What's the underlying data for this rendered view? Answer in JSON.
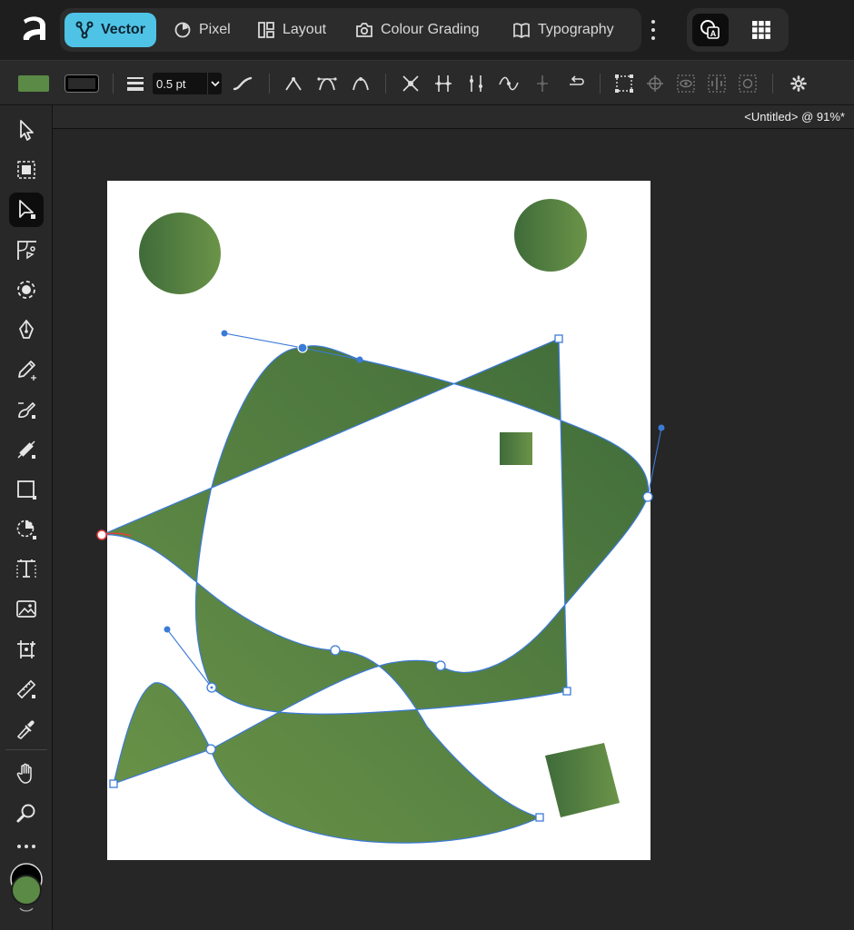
{
  "personas": [
    {
      "label": "Vector",
      "icon": "vector-persona-icon",
      "active": true
    },
    {
      "label": "Pixel",
      "icon": "pixel-persona-icon",
      "active": false
    },
    {
      "label": "Layout",
      "icon": "layout-persona-icon",
      "active": false
    },
    {
      "label": "Colour Grading",
      "icon": "camera-icon",
      "active": false
    },
    {
      "label": "Typography",
      "icon": "book-icon",
      "active": false
    }
  ],
  "context_toolbar": {
    "stroke_width": "0.5 pt"
  },
  "document": {
    "title": "<Untitled> @ 91%*"
  },
  "colors": {
    "accent": "#4fc3e6",
    "fill": "#5a8a45",
    "shape_dark": "#3f6b3a",
    "shape_light": "#6b9448",
    "path_selection": "#3b7bd8",
    "start_node": "#e0413b"
  },
  "tools": [
    "move-tool-icon",
    "artboard-select-tool-icon",
    "node-tool-icon",
    "corner-tool-icon",
    "shape-builder-tool-icon",
    "pen-tool-icon",
    "pencil-tool-icon",
    "vector-brush-tool-icon",
    "fill-tool-icon",
    "rectangle-tool-icon",
    "pie-tool-icon",
    "frame-text-tool-icon",
    "image-tool-icon",
    "place-tool-icon",
    "measure-tool-icon",
    "colour-picker-tool-icon",
    "hand-tool-icon",
    "zoom-tool-icon"
  ]
}
